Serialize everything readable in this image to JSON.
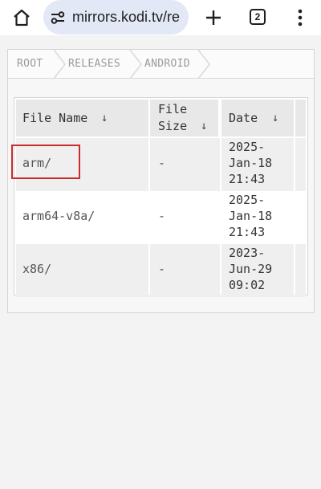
{
  "browser": {
    "url": "mirrors.kodi.tv/re",
    "tab_count": "2"
  },
  "breadcrumb": [
    "ROOT",
    "RELEASES",
    "ANDROID"
  ],
  "table": {
    "headers": {
      "name": [
        "File Name",
        "↓"
      ],
      "size_line1": "File",
      "size_line2": "Size",
      "size_arrow": "↓",
      "date": [
        "Date",
        "↓"
      ]
    },
    "rows": [
      {
        "name": "arm/",
        "size": "-",
        "date": [
          "2025-",
          "Jan-18",
          "21:43"
        ]
      },
      {
        "name": "arm64-v8a/",
        "size": "-",
        "date": [
          "2025-",
          "Jan-18",
          "21:43"
        ]
      },
      {
        "name": "x86/",
        "size": "-",
        "date": [
          "2023-",
          "Jun-29",
          "09:02"
        ]
      }
    ]
  },
  "colors": {
    "highlight": "#cc2b2b",
    "omnibox": "#e3e8f6"
  }
}
